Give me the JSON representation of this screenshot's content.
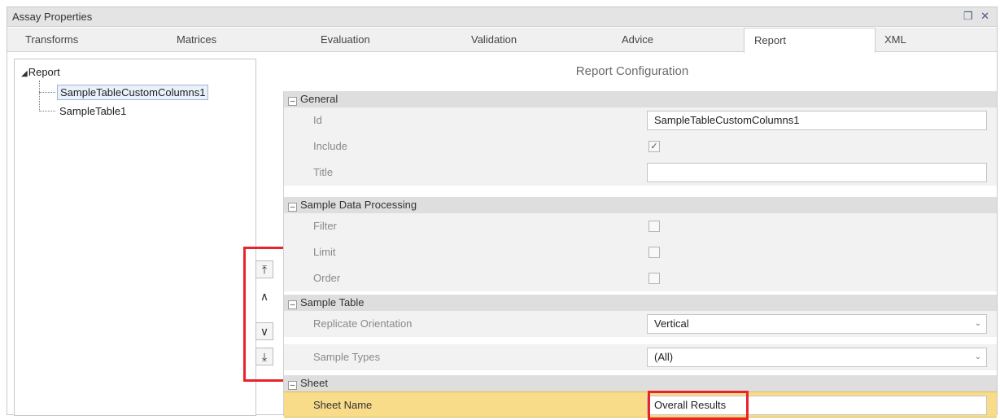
{
  "window": {
    "title": "Assay Properties",
    "controls": "❒ ✕"
  },
  "tabs": [
    "Transforms",
    "Matrices",
    "Evaluation",
    "Validation",
    "Advice",
    "Report",
    "XML"
  ],
  "active_tab": "Report",
  "tree": {
    "root": "Report",
    "items": [
      "SampleTableCustomColumns1",
      "SampleTable1"
    ],
    "selected": "SampleTableCustomColumns1"
  },
  "move_buttons": {
    "top": "⤒",
    "up": "∧",
    "down": "∨",
    "bottom": "⤓"
  },
  "config": {
    "title": "Report Configuration",
    "sections": {
      "general": "General",
      "sample_data_processing": "Sample Data Processing",
      "sample_table": "Sample Table",
      "sheet": "Sheet"
    },
    "fields": {
      "id_label": "Id",
      "id_value": "SampleTableCustomColumns1",
      "include_label": "Include",
      "include_checked": "✓",
      "title_label": "Title",
      "title_value": "",
      "filter_label": "Filter",
      "limit_label": "Limit",
      "order_label": "Order",
      "replicate_label": "Replicate Orientation",
      "replicate_value": "Vertical",
      "sample_types_label": "Sample Types",
      "sample_types_value": "(All)",
      "sheet_name_label": "Sheet Name",
      "sheet_name_value": "Overall Results"
    }
  },
  "colors": {
    "highlight_border": "#e8232d",
    "selected_row": "#f8dc8a"
  }
}
